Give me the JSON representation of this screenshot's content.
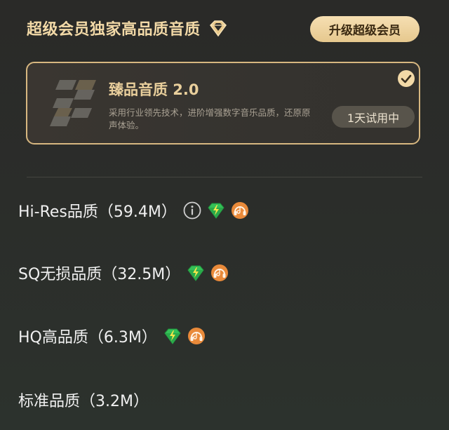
{
  "header": {
    "title": "超级会员独家高品质音质",
    "upgrade_label": "升级超级会员"
  },
  "card": {
    "title": "臻品音质 2.0",
    "description": "采用行业领先技术，进阶增强数字音乐品质，还原原声体验。",
    "trial_label": "1天试用中",
    "selected": true
  },
  "options": [
    {
      "label": "Hi-Res品质（59.4M）",
      "icons": [
        "info-icon",
        "diamond-bolt-icon",
        "headphone-icon"
      ]
    },
    {
      "label": "SQ无损品质（32.5M）",
      "icons": [
        "diamond-bolt-icon",
        "headphone-icon"
      ]
    },
    {
      "label": "HQ高品质（6.3M）",
      "icons": [
        "diamond-bolt-icon",
        "headphone-icon"
      ]
    },
    {
      "label": "标准品质（3.2M）",
      "icons": []
    }
  ],
  "colors": {
    "accent_gold": "#f2d9a7",
    "card_border": "#d7b780",
    "diamond_green": "#38c45a",
    "headphone_orange": "#e98a3a"
  }
}
